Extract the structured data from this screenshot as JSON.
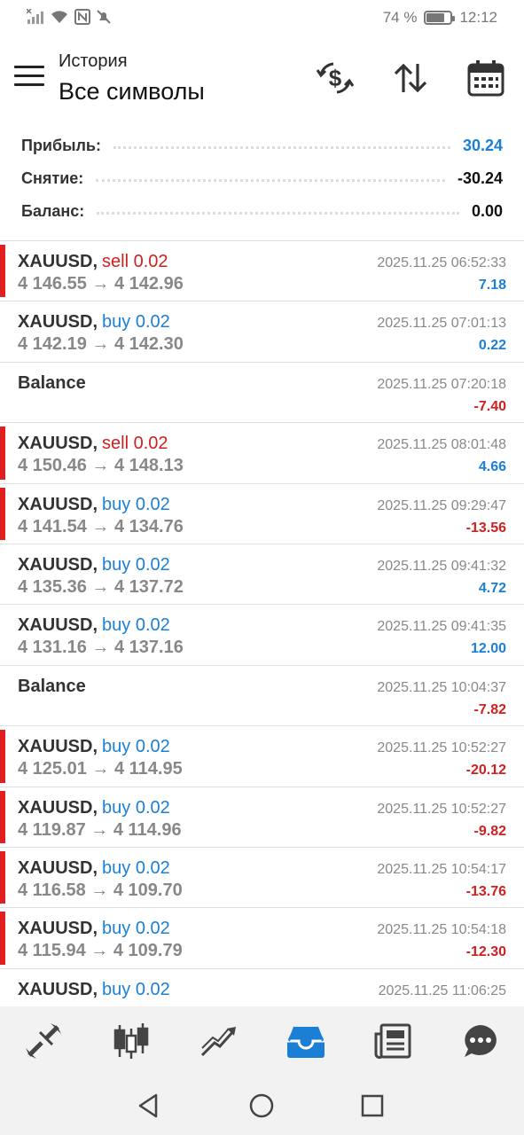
{
  "status_bar": {
    "battery_text": "74 %",
    "battery_level": 0.74,
    "time": "12:12",
    "icons": [
      "signal-icon",
      "wifi-icon",
      "nfc-icon",
      "mute-icon",
      "battery-icon"
    ]
  },
  "header": {
    "subtitle": "История",
    "title": "Все символы",
    "icons": [
      "menu-icon",
      "currency-exchange-icon",
      "sort-icon",
      "calendar-icon"
    ]
  },
  "summary": {
    "profit_label": "Прибыль:",
    "profit_value": "30.24",
    "withdrawal_label": "Снятие:",
    "withdrawal_value": "-30.24",
    "balance_label": "Баланс:",
    "balance_value": "0.00"
  },
  "colors": {
    "buy": "#1b7fd6",
    "sell": "#d02020",
    "loss_marker": "#e02020",
    "nav_active": "#1b7fd6"
  },
  "rows": [
    {
      "kind": "trade",
      "symbol": "XAUUSD,",
      "side": "sell",
      "volume": "sell 0.02",
      "prices": "4 146.55 → 4 142.96",
      "date": "2025.11.25 06:52:33",
      "profit": "7.18",
      "marker": true
    },
    {
      "kind": "trade",
      "symbol": "XAUUSD,",
      "side": "buy",
      "volume": "buy 0.02",
      "prices": "4 142.19 → 4 142.30",
      "date": "2025.11.25 07:01:13",
      "profit": "0.22",
      "marker": false
    },
    {
      "kind": "balance",
      "title": "Balance",
      "date": "2025.11.25 07:20:18",
      "profit": "-7.40",
      "marker": false
    },
    {
      "kind": "trade",
      "symbol": "XAUUSD,",
      "side": "sell",
      "volume": "sell 0.02",
      "prices": "4 150.46 → 4 148.13",
      "date": "2025.11.25 08:01:48",
      "profit": "4.66",
      "marker": true
    },
    {
      "kind": "trade",
      "symbol": "XAUUSD,",
      "side": "buy",
      "volume": "buy 0.02",
      "prices": "4 141.54 → 4 134.76",
      "date": "2025.11.25 09:29:47",
      "profit": "-13.56",
      "marker": true
    },
    {
      "kind": "trade",
      "symbol": "XAUUSD,",
      "side": "buy",
      "volume": "buy 0.02",
      "prices": "4 135.36 → 4 137.72",
      "date": "2025.11.25 09:41:32",
      "profit": "4.72",
      "marker": false
    },
    {
      "kind": "trade",
      "symbol": "XAUUSD,",
      "side": "buy",
      "volume": "buy 0.02",
      "prices": "4 131.16 → 4 137.16",
      "date": "2025.11.25 09:41:35",
      "profit": "12.00",
      "marker": false
    },
    {
      "kind": "balance",
      "title": "Balance",
      "date": "2025.11.25 10:04:37",
      "profit": "-7.82",
      "marker": false
    },
    {
      "kind": "trade",
      "symbol": "XAUUSD,",
      "side": "buy",
      "volume": "buy 0.02",
      "prices": "4 125.01 → 4 114.95",
      "date": "2025.11.25 10:52:27",
      "profit": "-20.12",
      "marker": true
    },
    {
      "kind": "trade",
      "symbol": "XAUUSD,",
      "side": "buy",
      "volume": "buy 0.02",
      "prices": "4 119.87 → 4 114.96",
      "date": "2025.11.25 10:52:27",
      "profit": "-9.82",
      "marker": true
    },
    {
      "kind": "trade",
      "symbol": "XAUUSD,",
      "side": "buy",
      "volume": "buy 0.02",
      "prices": "4 116.58 → 4 109.70",
      "date": "2025.11.25 10:54:17",
      "profit": "-13.76",
      "marker": true
    },
    {
      "kind": "trade",
      "symbol": "XAUUSD,",
      "side": "buy",
      "volume": "buy 0.02",
      "prices": "4 115.94 → 4 109.79",
      "date": "2025.11.25 10:54:18",
      "profit": "-12.30",
      "marker": true
    },
    {
      "kind": "trade",
      "symbol": "XAUUSD,",
      "side": "buy",
      "volume": "buy 0.02",
      "prices": "",
      "date": "2025.11.25 11:06:25",
      "profit": "",
      "marker": false
    }
  ],
  "bottom_nav": [
    {
      "name": "quotes",
      "icon": "quotes-arrows-icon",
      "active": false
    },
    {
      "name": "chart",
      "icon": "candlestick-icon",
      "active": false
    },
    {
      "name": "trade",
      "icon": "trade-chart-icon",
      "active": false
    },
    {
      "name": "history",
      "icon": "history-inbox-icon",
      "active": true
    },
    {
      "name": "news",
      "icon": "news-icon",
      "active": false
    },
    {
      "name": "messages",
      "icon": "chat-icon",
      "active": false
    }
  ],
  "system_nav": [
    "back-icon",
    "home-icon",
    "recents-icon"
  ]
}
